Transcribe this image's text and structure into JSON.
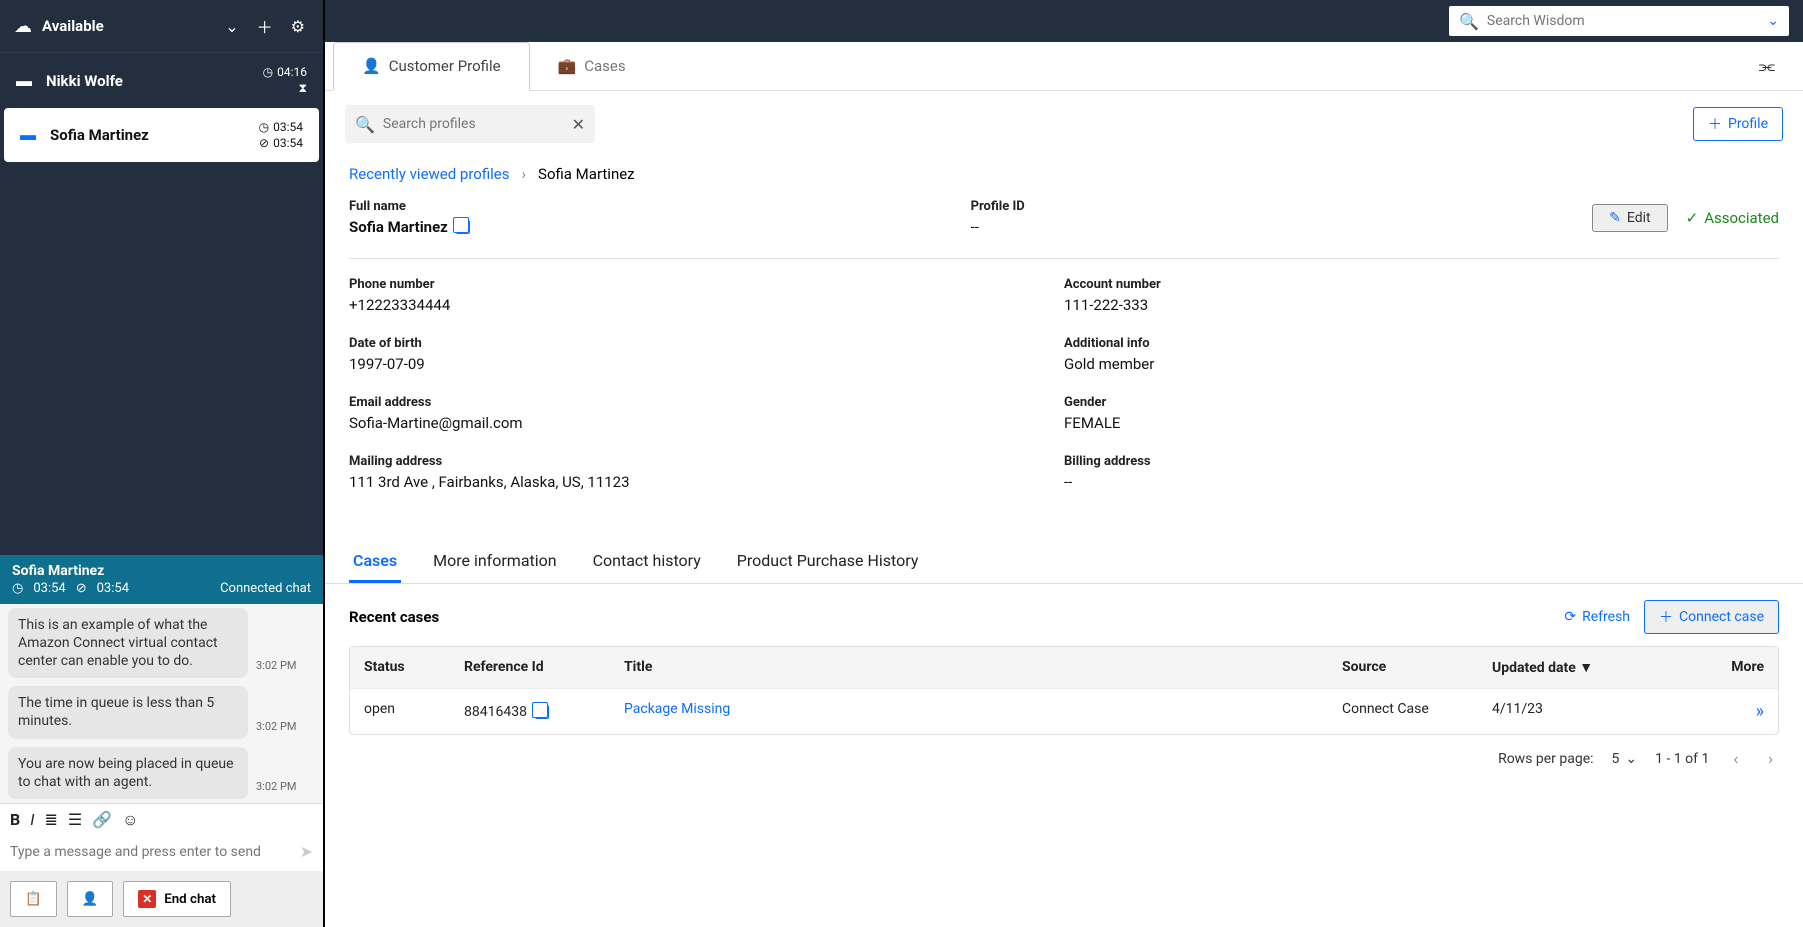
{
  "sidebar": {
    "status": "Available",
    "contacts": [
      {
        "name": "Nikki Wolfe",
        "t1": "04:16",
        "t2": ""
      },
      {
        "name": "Sofia Martinez",
        "t1": "03:54",
        "t2": "03:54"
      }
    ]
  },
  "session": {
    "name": "Sofia Martinez",
    "t1": "03:54",
    "t2": "03:54",
    "status": "Connected chat"
  },
  "messages": [
    {
      "text": "This is an example of what the Amazon Connect virtual contact center can enable you to do.",
      "time": "3:02 PM"
    },
    {
      "text": "The time in queue is less than 5 minutes.",
      "time": "3:02 PM"
    },
    {
      "text": "You are now being placed in queue to chat with an agent.",
      "time": "3:02 PM"
    }
  ],
  "composer": {
    "placeholder": "Type a message and press enter to send",
    "end_label": "End chat"
  },
  "topsearch": {
    "placeholder": "Search Wisdom"
  },
  "tabs": {
    "profile": "Customer Profile",
    "cases": "Cases"
  },
  "profsearch": {
    "placeholder": "Search profiles"
  },
  "addprofile": "Profile",
  "breadcrumb": {
    "link": "Recently viewed profiles",
    "current": "Sofia Martinez"
  },
  "profile": {
    "fullname_label": "Full name",
    "fullname": "Sofia Martinez",
    "profileid_label": "Profile ID",
    "profileid": "--",
    "edit": "Edit",
    "associated": "Associated",
    "phone_label": "Phone number",
    "phone": "+12223334444",
    "account_label": "Account number",
    "account": "111-222-333",
    "dob_label": "Date of birth",
    "dob": "1997-07-09",
    "addl_label": "Additional info",
    "addl": "Gold member",
    "email_label": "Email address",
    "email": "Sofia-Martine@gmail.com",
    "gender_label": "Gender",
    "gender": "FEMALE",
    "mailing_label": "Mailing address",
    "mailing": "111 3rd Ave , Fairbanks, Alaska, US, 11123",
    "billing_label": "Billing address",
    "billing": "--"
  },
  "subtabs": [
    "Cases",
    "More information",
    "Contact history",
    "Product Purchase History"
  ],
  "cases": {
    "heading": "Recent cases",
    "refresh": "Refresh",
    "connect": "Connect case",
    "columns": {
      "status": "Status",
      "ref": "Reference Id",
      "title": "Title",
      "source": "Source",
      "date": "Updated date",
      "more": "More"
    },
    "rows": [
      {
        "status": "open",
        "ref": "88416438",
        "title": "Package Missing",
        "source": "Connect Case",
        "date": "4/11/23"
      }
    ]
  },
  "pager": {
    "label": "Rows per page:",
    "size": "5",
    "range": "1 - 1 of 1"
  }
}
